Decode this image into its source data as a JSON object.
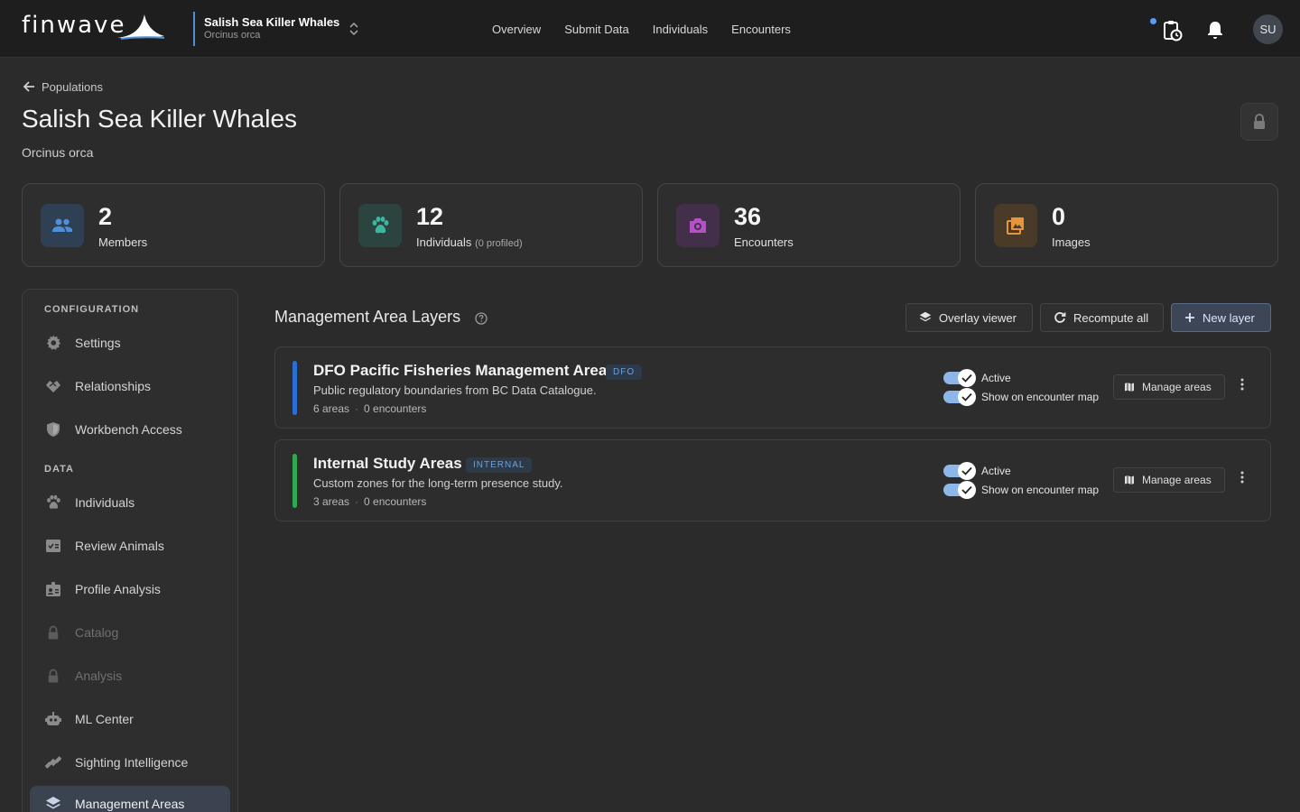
{
  "app": {
    "logo_text": "finwave"
  },
  "population_switcher": {
    "name": "Salish Sea Killer Whales",
    "species": "Orcinus orca"
  },
  "nav": [
    "Overview",
    "Submit Data",
    "Individuals",
    "Encounters"
  ],
  "user": {
    "initials": "SU"
  },
  "header": {
    "back_label": "Populations",
    "title": "Salish Sea Killer Whales",
    "subtitle": "Orcinus orca"
  },
  "stats": [
    {
      "value": "2",
      "label": "Members",
      "note": "",
      "icon": "people-icon",
      "color": "#4d8fd8"
    },
    {
      "value": "12",
      "label": "Individuals",
      "note": "(0 profiled)",
      "icon": "paw-icon",
      "color": "#3fb4a0"
    },
    {
      "value": "36",
      "label": "Encounters",
      "note": "",
      "icon": "camera-icon",
      "color": "#b64fc8"
    },
    {
      "value": "0",
      "label": "Images",
      "note": "",
      "icon": "images-icon",
      "color": "#e5963a"
    }
  ],
  "sidebar": {
    "config_header": "CONFIGURATION",
    "data_header": "DATA",
    "config_items": [
      {
        "label": "Settings",
        "icon": "gear-icon"
      },
      {
        "label": "Relationships",
        "icon": "handshake-icon"
      },
      {
        "label": "Workbench Access",
        "icon": "shield-icon"
      }
    ],
    "data_items": [
      {
        "label": "Individuals",
        "icon": "paw-icon"
      },
      {
        "label": "Review Animals",
        "icon": "review-icon"
      },
      {
        "label": "Profile Analysis",
        "icon": "profile-badge-icon"
      },
      {
        "label": "Catalog",
        "icon": "lock-icon",
        "disabled": true
      },
      {
        "label": "Analysis",
        "icon": "lock-icon",
        "disabled": true
      },
      {
        "label": "ML Center",
        "icon": "robot-icon"
      },
      {
        "label": "Sighting Intelligence",
        "icon": "satellite-icon"
      },
      {
        "label": "Management Areas",
        "icon": "layers-icon",
        "active": true
      }
    ]
  },
  "main": {
    "section_title": "Management Area Layers",
    "buttons": {
      "overlay": "Overlay viewer",
      "recompute": "Recompute all",
      "new_layer": "New layer"
    },
    "layers": [
      {
        "name": "DFO Pacific Fisheries Management Areas",
        "tag": "DFO",
        "color": "#2a6fd6",
        "description": "Public regulatory boundaries from BC Data Catalogue.",
        "areas": "6 areas",
        "encounters": "0 encounters",
        "active_label": "Active",
        "active": true,
        "map_label": "Show on encounter map",
        "show_on_map": true,
        "manage_label": "Manage areas"
      },
      {
        "name": "Internal Study Areas",
        "tag": "INTERNAL",
        "color": "#2fa84f",
        "description": "Custom zones for the long-term presence study.",
        "areas": "3 areas",
        "encounters": "0 encounters",
        "active_label": "Active",
        "active": true,
        "map_label": "Show on encounter map",
        "show_on_map": true,
        "manage_label": "Manage areas"
      }
    ]
  }
}
